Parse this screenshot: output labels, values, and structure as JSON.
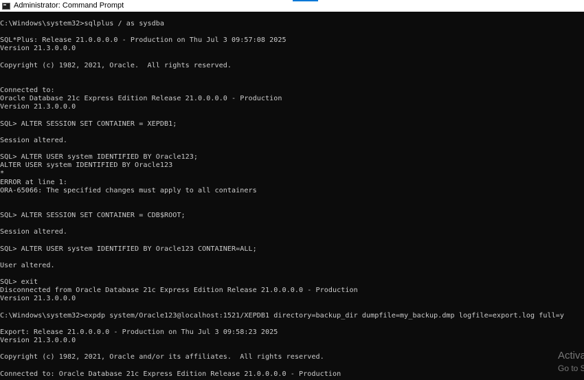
{
  "window": {
    "title": "Administrator: Command Prompt"
  },
  "console": {
    "lines": [
      "C:\\Windows\\system32>sqlplus / as sysdba",
      "SQL*Plus: Release 21.0.0.0.0 - Production on Thu Jul 3 09:57:08 2025",
      "Version 21.3.0.0.0",
      "Copyright (c) 1982, 2021, Oracle.  All rights reserved.",
      "Connected to:",
      "Oracle Database 21c Express Edition Release 21.0.0.0.0 - Production",
      "Version 21.3.0.0.0",
      "SQL> ALTER SESSION SET CONTAINER = XEPDB1;",
      "Session altered.",
      "SQL> ALTER USER system IDENTIFIED BY Oracle123;",
      "ALTER USER system IDENTIFIED BY Oracle123",
      "*",
      "ERROR at line 1:",
      "ORA-65066: The specified changes must apply to all containers",
      "SQL> ALTER SESSION SET CONTAINER = CDB$ROOT;",
      "Session altered.",
      "SQL> ALTER USER system IDENTIFIED BY Oracle123 CONTAINER=ALL;",
      "User altered.",
      "SQL> exit",
      "Disconnected from Oracle Database 21c Express Edition Release 21.0.0.0.0 - Production",
      "Version 21.3.0.0.0",
      "C:\\Windows\\system32>expdp system/Oracle123@localhost:1521/XEPDB1 directory=backup_dir dumpfile=my_backup.dmp logfile=export.log full=y",
      "Export: Release 21.0.0.0.0 - Production on Thu Jul 3 09:58:23 2025",
      "Version 21.3.0.0.0",
      "Copyright (c) 1982, 2021, Oracle and/or its affiliates.  All rights reserved.",
      "Connected to: Oracle Database 21c Express Edition Release 21.0.0.0.0 - Production"
    ]
  },
  "watermark": {
    "title": "Activa",
    "subtitle": "Go to S"
  },
  "colors": {
    "console_background": "#0c0c0c",
    "console_text": "#cccccc",
    "titlebar_background": "#ffffff"
  }
}
